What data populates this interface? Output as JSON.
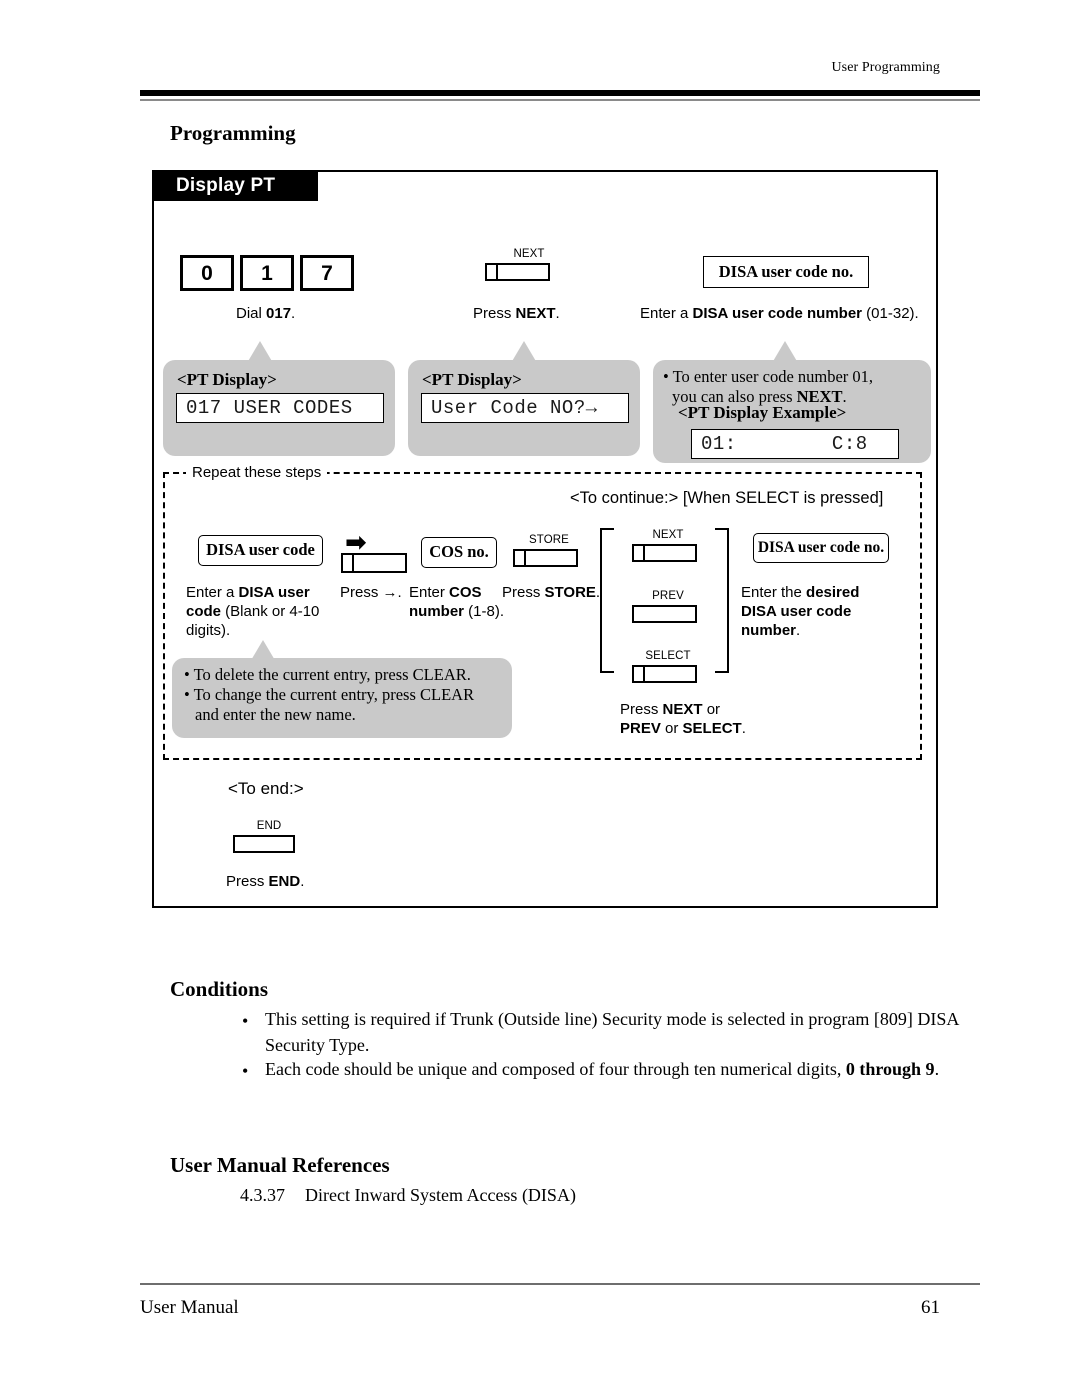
{
  "header": {
    "running_head": "User Programming"
  },
  "sections": {
    "programming_title": "Programming",
    "conditions_title": "Conditions",
    "references_title": "User Manual References"
  },
  "display_pt": {
    "tab_label": "Display PT",
    "step_dial": {
      "keys": [
        "0",
        "1",
        "7"
      ],
      "caption_prefix": "Dial ",
      "caption_bold": "017",
      "caption_suffix": ".",
      "bubble_title": "<PT Display>",
      "lcd_text": "017 USER CODES"
    },
    "step_next": {
      "key_label": "NEXT",
      "caption_prefix": "Press ",
      "caption_bold": "NEXT",
      "caption_suffix": ".",
      "bubble_title": "<PT Display>",
      "lcd_text": "User Code NO?→"
    },
    "step_code_no": {
      "box_label": "DISA user code no.",
      "caption_prefix": "Enter a ",
      "caption_bold": "DISA user code number",
      "caption_suffix": " (01-32).",
      "bubble_line1_prefix": "• To enter user code number 01,",
      "bubble_line2_prefix": "you can also press ",
      "bubble_line2_bold": "NEXT",
      "bubble_line2_suffix": ".",
      "bubble_title": "<PT Display Example>",
      "lcd_text": "01:        C:8"
    },
    "repeat_region": {
      "repeat_label": "Repeat these steps",
      "continue_label": "<To continue:> [When SELECT is pressed]",
      "step_user_code": {
        "box_label": "DISA user code",
        "caption_line1_prefix": "Enter a ",
        "caption_line1_bold": "DISA user",
        "caption_line2_bold": "code",
        "caption_line2_rest": " (Blank or 4-10",
        "caption_line3": "digits)."
      },
      "step_arrow": {
        "arrow_glyph": "➡",
        "caption": "Press →."
      },
      "step_cos": {
        "box_label": "COS no.",
        "caption_line1_prefix": "Enter ",
        "caption_line1_bold": "COS",
        "caption_line2_bold": "number",
        "caption_line2_rest": " (1-8)."
      },
      "step_store": {
        "key_label": "STORE",
        "caption_prefix": "Press ",
        "caption_bold": "STORE",
        "caption_suffix": "."
      },
      "bubble_clear": {
        "line1": "• To delete the current entry, press CLEAR.",
        "line2": "• To change the current entry, press CLEAR",
        "line3": "and enter the new name."
      },
      "nav_keys": {
        "next_label": "NEXT",
        "prev_label": "PREV",
        "select_label": "SELECT",
        "caption_line1_prefix": "Press ",
        "caption_line1_bold": "NEXT",
        "caption_line1_suffix": " or",
        "caption_line2_bold1": "PREV",
        "caption_line2_mid": " or ",
        "caption_line2_bold2": "SELECT",
        "caption_line2_suffix": "."
      },
      "step_desired_code": {
        "box_label": "DISA user code no.",
        "caption_line1_prefix": "Enter the ",
        "caption_line1_bold": "desired",
        "caption_line2_bold": "DISA user code number",
        "caption_line2_suffix": "."
      }
    },
    "end_region": {
      "to_end_label": "<To end:>",
      "key_label": "END",
      "caption_prefix": "Press ",
      "caption_bold": "END",
      "caption_suffix": "."
    }
  },
  "conditions": {
    "bullet": "•",
    "items": [
      {
        "pre": "This setting is required if Trunk (Outside line) Security mode is selected in program [809] DISA Security Type.",
        "bold": "",
        "post": ""
      },
      {
        "pre": "Each code should be unique and composed of four through ten numerical digits, ",
        "bold": "0 through 9",
        "post": "."
      }
    ]
  },
  "references": {
    "number": "4.3.37",
    "text": "Direct Inward System Access (DISA)"
  },
  "footer": {
    "left": "User Manual",
    "page_number": "61"
  },
  "colors": {
    "bubble_gray": "#c9c9c9",
    "tab_black": "#000000",
    "rule_gray": "#8a8a8a"
  }
}
